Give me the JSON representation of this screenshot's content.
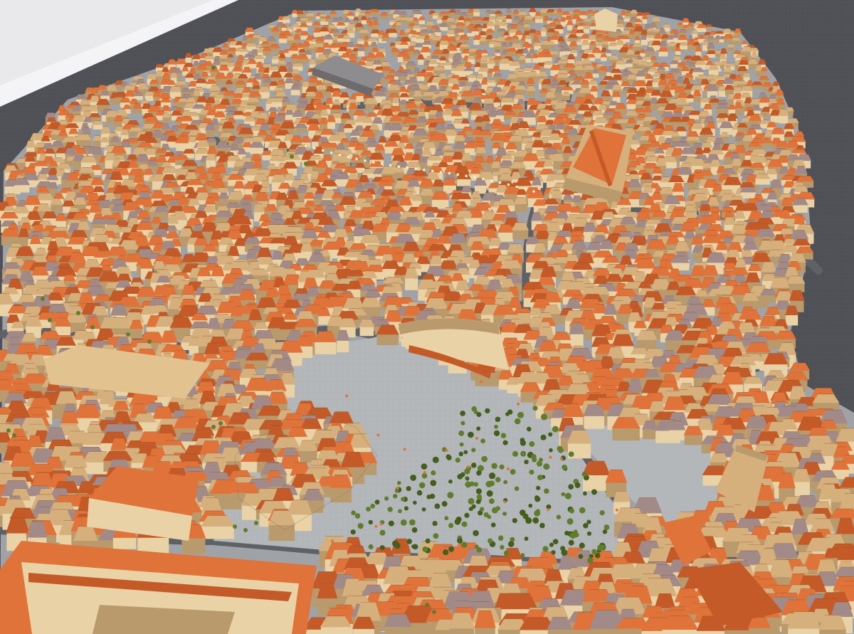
{
  "scene": {
    "kind": "3d-city-model-render",
    "view": "aerial-oblique",
    "colors": {
      "sky": "#e9e9ec",
      "ground": "#505257",
      "plaza": "#b4b7ba",
      "sidewalk": "#9fa3a7",
      "street": "#5e6166",
      "roof_orange": "#e0733a",
      "roof_orange_dark": "#c35a27",
      "roof_tan": "#d6b07c",
      "roof_mauve": "#a18a88",
      "wall_light": "#e9d3a6",
      "wall_shade": "#b99a6c",
      "tree": "#5f7d2d",
      "tree_dark": "#435e1d",
      "street_light": "#f5eec3"
    },
    "elements": [
      {
        "name": "city-block-north",
        "type": "building-cluster"
      },
      {
        "name": "city-block-west",
        "type": "building-cluster"
      },
      {
        "name": "city-block-east",
        "type": "building-cluster"
      },
      {
        "name": "central-square-plaza",
        "type": "plaza"
      },
      {
        "name": "plaza-tree-grove",
        "type": "vegetation"
      },
      {
        "name": "central-island-block",
        "type": "building-cluster"
      },
      {
        "name": "large-hall-northeast",
        "type": "landmark-building"
      },
      {
        "name": "curved-facade-building",
        "type": "landmark-building"
      },
      {
        "name": "foreground-long-building",
        "type": "landmark-building"
      },
      {
        "name": "lit-street-northwest",
        "type": "street"
      }
    ]
  }
}
